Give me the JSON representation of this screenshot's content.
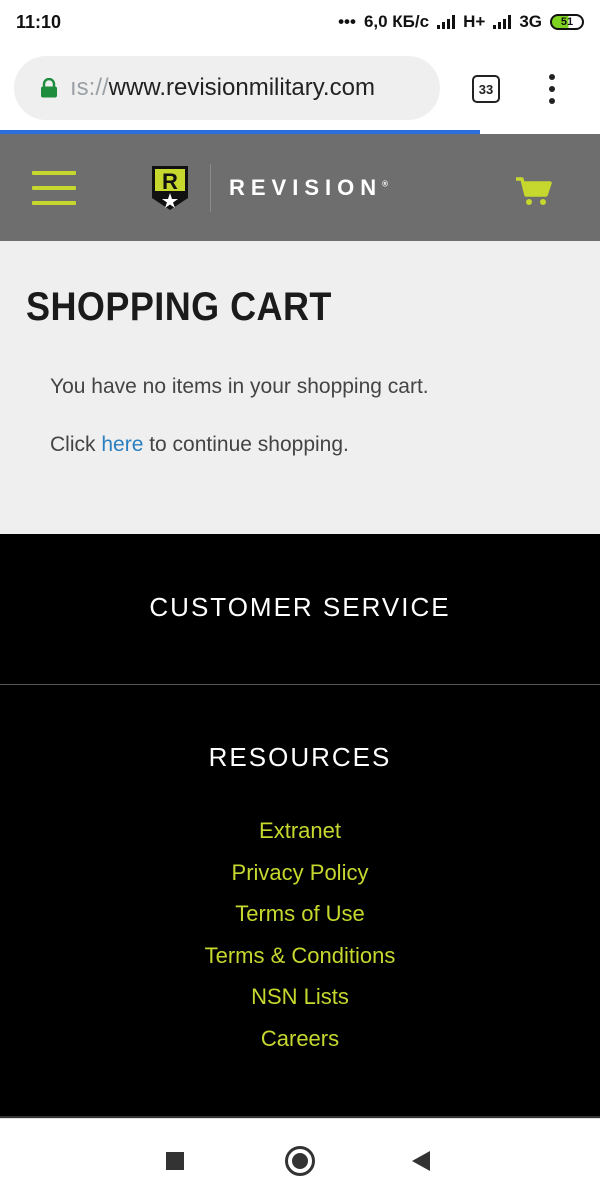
{
  "status_bar": {
    "time": "11:10",
    "dots": "•••",
    "network_speed": "6,0 КБ/с",
    "network_type_1": "H+",
    "network_type_2": "3G",
    "battery_level": "51"
  },
  "browser": {
    "url_prefix": "ıs://",
    "url_host": "www.revisionmilitary.com",
    "tab_count": "33",
    "load_progress_percent": 80,
    "lock_color": "#1e8e3e"
  },
  "header": {
    "brand_name": "REVISION",
    "brand_mark": "®",
    "logo_letter": "R",
    "accent_color": "#c6d82e",
    "icons": {
      "menu": "hamburger-icon",
      "cart": "cart-icon",
      "logo": "shield-logo-icon"
    }
  },
  "main": {
    "title": "SHOPPING CART",
    "empty_message": "You have no items in your shopping cart.",
    "continue_before": "Click ",
    "continue_link": "here",
    "continue_after": " to continue shopping."
  },
  "footer": {
    "customer_service_heading": "CUSTOMER SERVICE",
    "resources_heading": "RESOURCES",
    "resource_links": [
      "Extranet",
      "Privacy Policy",
      "Terms of Use",
      "Terms & Conditions",
      "NSN Lists",
      "Careers"
    ]
  },
  "nav_bar": {
    "icons": [
      "recents-square-icon",
      "home-circle-icon",
      "back-triangle-icon"
    ]
  }
}
